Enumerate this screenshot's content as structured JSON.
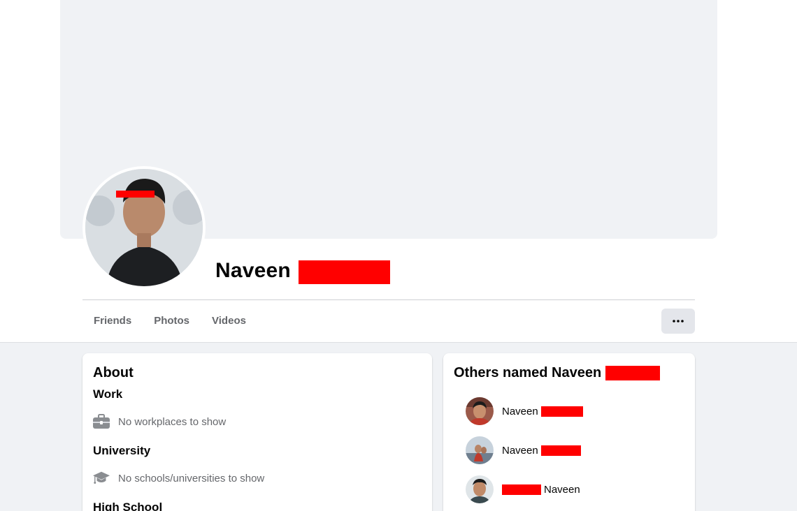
{
  "profile": {
    "name": "Naveen"
  },
  "tabs": [
    {
      "label": "Friends"
    },
    {
      "label": "Photos"
    },
    {
      "label": "Videos"
    }
  ],
  "more_button": {
    "icon": "more-horizontal-icon"
  },
  "about": {
    "title": "About",
    "work": {
      "title": "Work",
      "text": "No workplaces to show",
      "icon": "briefcase-icon"
    },
    "university": {
      "title": "University",
      "text": "No schools/universities to show",
      "icon": "graduation-cap-icon"
    },
    "high_school": {
      "title": "High School"
    }
  },
  "others": {
    "title": "Others named Naveen",
    "people": [
      {
        "name": "Naveen"
      },
      {
        "name": "Naveen"
      },
      {
        "name": "Naveen"
      }
    ]
  },
  "colors": {
    "redaction": "#ff0000",
    "secondary_text": "#65676b",
    "page_background": "#f0f2f5"
  }
}
